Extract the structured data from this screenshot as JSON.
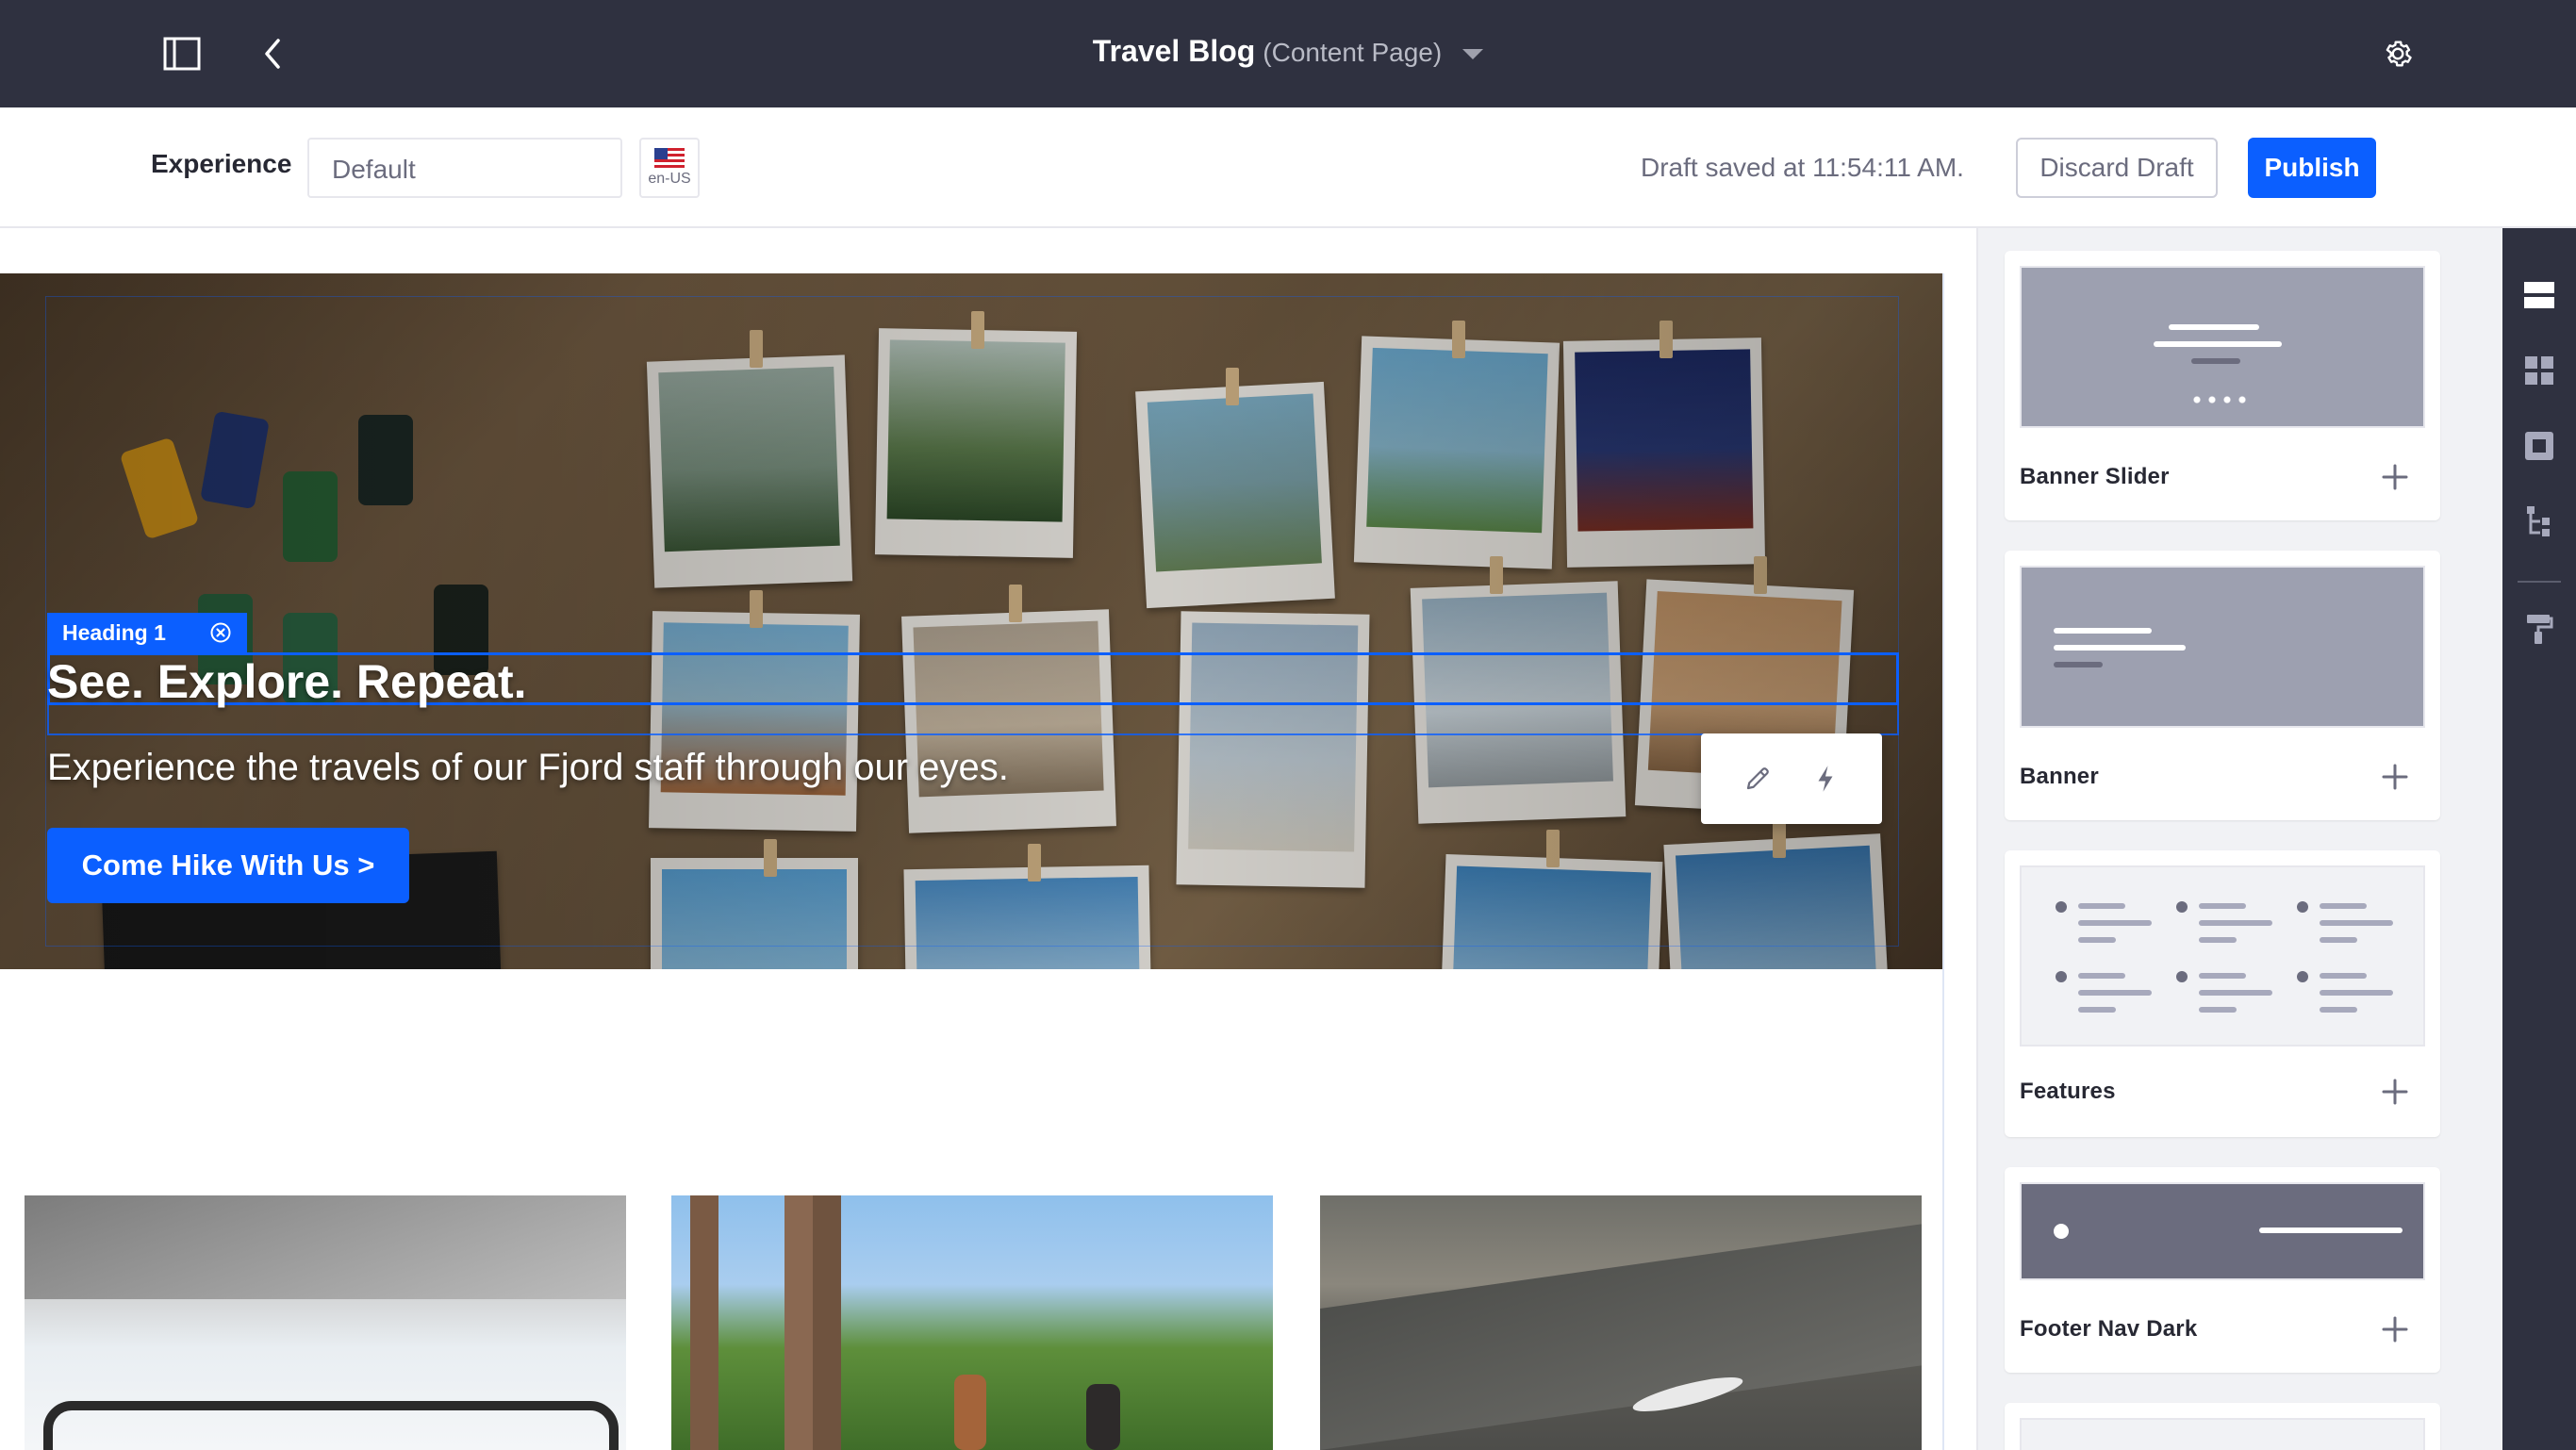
{
  "topbar": {
    "title": "Travel Blog",
    "subtitle": "(Content Page)",
    "icons": [
      "sidebar-toggle-icon",
      "back-arrow-icon",
      "caret-down-icon",
      "gear-icon"
    ]
  },
  "toolbar": {
    "experience_label": "Experience",
    "experience_value": "Default",
    "language": "en-US",
    "draft_status": "Draft saved at 11:54:11 AM.",
    "discard_label": "Discard Draft",
    "publish_label": "Publish"
  },
  "hero": {
    "tag_label": "Heading 1",
    "title": "See. Explore. Repeat.",
    "subtitle": "Experience the travels of our Fjord staff through our eyes.",
    "button_label": "Come Hike With Us >",
    "tools": [
      "pencil-icon",
      "lightning-icon"
    ]
  },
  "cards": [
    {
      "subject": "train window"
    },
    {
      "subject": "baobab trees"
    },
    {
      "subject": "ship and seagull"
    }
  ],
  "fragments": [
    {
      "name": "Banner Slider"
    },
    {
      "name": "Banner"
    },
    {
      "name": "Features"
    },
    {
      "name": "Footer Nav Dark"
    }
  ],
  "rail": {
    "icons": [
      "sections-icon",
      "grid-icon",
      "widget-icon",
      "tree-icon",
      "paint-roller-icon"
    ]
  },
  "colors": {
    "primary": "#0b5fff",
    "dark": "#2f3140",
    "panel": "#f1f2f5"
  }
}
